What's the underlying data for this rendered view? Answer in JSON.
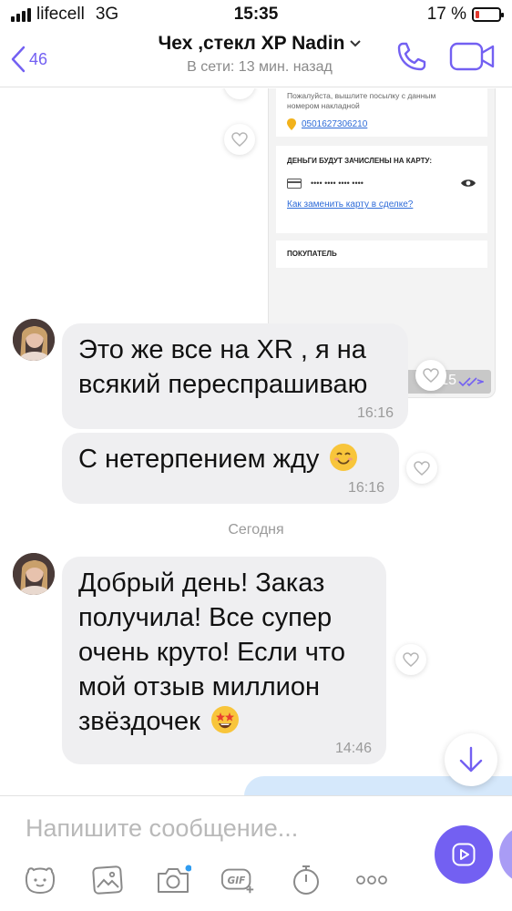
{
  "status_bar": {
    "carrier": "lifecell",
    "network": "3G",
    "time": "15:35",
    "battery_text": "17 %",
    "battery_level": 0.17
  },
  "header": {
    "back_count": "46",
    "contact_name": "Чех ,стекл XP Nadin",
    "presence": "В сети: 13 мин. назад",
    "accent_color": "#7360f2"
  },
  "forwarded_screenshot": {
    "note_text": "Пожалуйста, вышлите посылку с данным номером накладной",
    "tracking_number": "0501627306210",
    "card_heading": "ДЕНЬГИ БУДУТ ЗАЧИСЛЕНЫ НА КАРТУ:",
    "card_masked": "•••• •••• •••• ••••",
    "change_card_link": "Как заменить карту в сделке?",
    "buyer_heading": "ПОКУПАТЕЛЬ",
    "time": "16:15"
  },
  "messages": [
    {
      "text": "Это же все на XR , я на всякий переспрашиваю",
      "time": "16:16"
    },
    {
      "text": "С нетерпением жду",
      "time": "16:16",
      "emoji": "smiling-face-icon"
    },
    {
      "text": "Добрый день! Заказ получила! Все супер очень круто! Если что мой отзыв миллион звёздочек",
      "time": "14:46",
      "emoji": "star-struck-icon"
    }
  ],
  "date_separator": "Сегодня",
  "composer": {
    "placeholder": "Напишите сообщение..."
  },
  "toolbar_icons": [
    "sticker-icon",
    "gallery-icon",
    "camera-icon",
    "gif-icon",
    "timer-icon",
    "more-icon"
  ],
  "colors": {
    "incoming_bubble": "#efeff1",
    "outgoing_bubble": "#d5e8fb",
    "timestamp": "#9a9a9a"
  }
}
